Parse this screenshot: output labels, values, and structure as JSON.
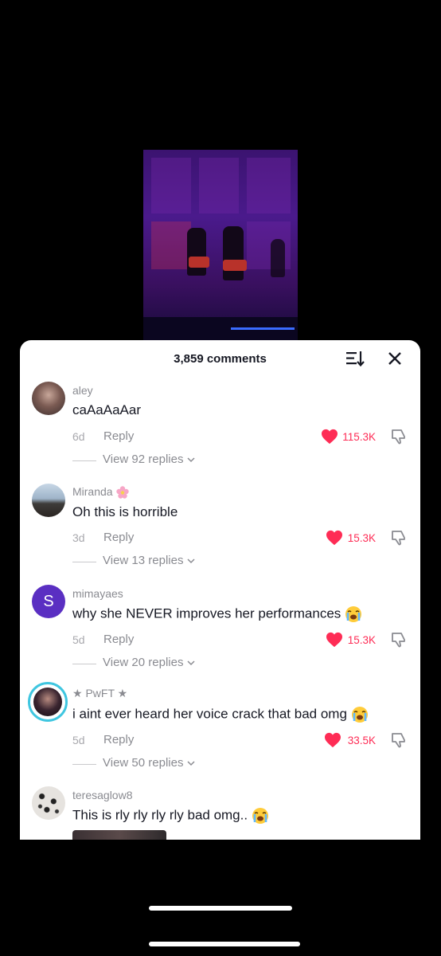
{
  "comments_panel": {
    "count_label": "3,859 comments"
  },
  "comments": [
    {
      "username": "aley",
      "text": "caAaAaAar",
      "age": "6d",
      "reply_label": "Reply",
      "likes": "115.3K",
      "view_replies": "View 92 replies"
    },
    {
      "username": "Miranda",
      "username_emoji": "pink-flower-emoji",
      "text": "Oh this is horrible",
      "age": "3d",
      "reply_label": "Reply",
      "likes": "15.3K",
      "view_replies": "View 13 replies"
    },
    {
      "username": "mimayaes",
      "avatar_letter": "S",
      "avatar_color": "#5a2fc2",
      "text": "why she NEVER improves her performances",
      "text_emoji": "loudly-crying-emoji",
      "age": "5d",
      "reply_label": "Reply",
      "likes": "15.3K",
      "view_replies": "View 20 replies"
    },
    {
      "username": "★ PwFT ★",
      "text": "i aint ever heard her voice crack that bad omg",
      "text_emoji": "loudly-crying-emoji",
      "age": "5d",
      "reply_label": "Reply",
      "likes": "33.5K",
      "view_replies": "View 50 replies"
    },
    {
      "username": "teresaglow8",
      "text": "This is rly rly rly rly bad omg..",
      "text_emoji": "loudly-crying-emoji"
    }
  ],
  "colors": {
    "like_red": "#fe2c55",
    "muted_gray": "#8a8b91",
    "text_dark": "#161823"
  }
}
